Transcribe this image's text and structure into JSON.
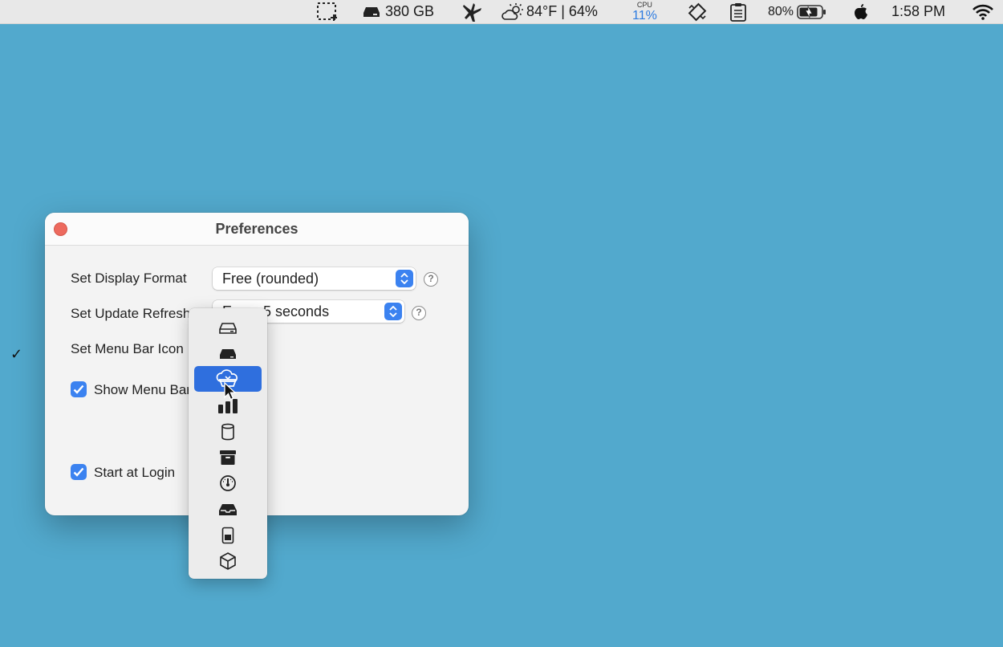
{
  "menubar": {
    "disk_text": "380 GB",
    "weather_text": "84°F | 64%",
    "cpu_label": "CPU",
    "cpu_value": "11%",
    "battery_text": "80%",
    "time": "1:58 PM",
    "icons": [
      "screenshot-icon",
      "disk-icon",
      "app-figure-icon",
      "weather-icon",
      "cpu-monitor",
      "rotate-icon",
      "clipboard-icon",
      "battery-icon",
      "apple-icon",
      "wifi-icon"
    ]
  },
  "window": {
    "title": "Preferences",
    "display_format": {
      "label": "Set Display Format",
      "value": "Free (rounded)"
    },
    "update_refresh": {
      "label": "Set Update Refresh",
      "value": "Every 5 seconds"
    },
    "menu_bar_icon": {
      "label": "Set Menu Bar Icon"
    },
    "show_menu_bar": {
      "label": "Show Menu Bar",
      "checked": true
    },
    "start_at_login": {
      "label": "Start at Login",
      "checked": true
    },
    "help_glyph": "?"
  },
  "icon_menu": {
    "checked_index": 1,
    "highlighted_index": 2,
    "items": [
      {
        "icon": "drive-outline-icon"
      },
      {
        "icon": "drive-filled-icon"
      },
      {
        "icon": "cloud-drive-icon"
      },
      {
        "icon": "bar-chart-icon"
      },
      {
        "icon": "cylinder-icon"
      },
      {
        "icon": "archive-box-icon"
      },
      {
        "icon": "gauge-icon"
      },
      {
        "icon": "tray-icon"
      },
      {
        "icon": "sd-card-icon"
      },
      {
        "icon": "cube-icon"
      }
    ],
    "check_glyph": "✓"
  },
  "colors": {
    "desktop": "#52a9cd",
    "accent": "#3b82f0",
    "highlight": "#2f6fde",
    "close_button": "#ed6a5e"
  }
}
